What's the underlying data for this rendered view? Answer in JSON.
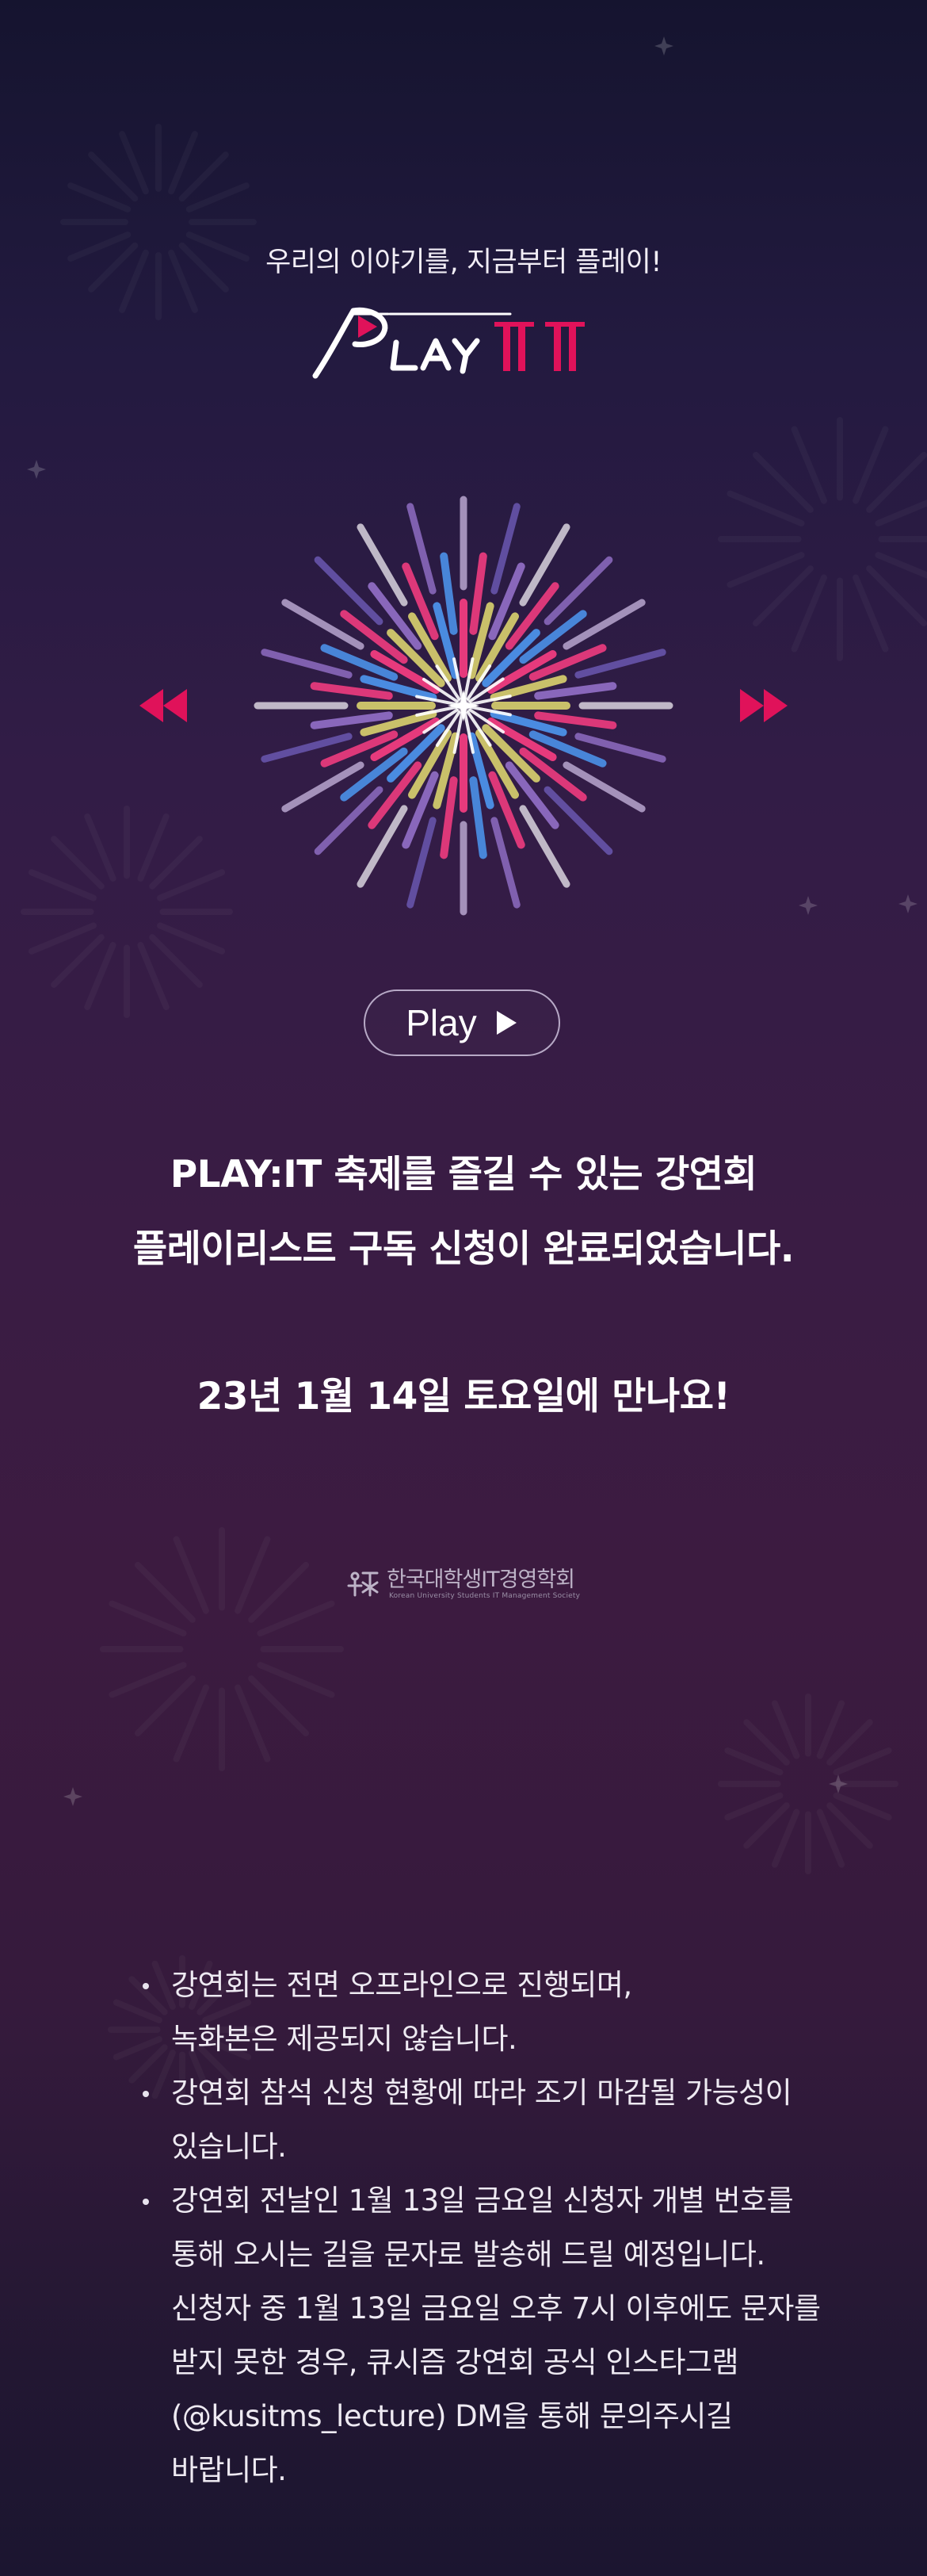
{
  "tagline": "우리의 이야기를, 지금부터 플레이!",
  "logo_text": "PLAY IT",
  "colors": {
    "accent": "#e0125a",
    "background_top": "#15142f",
    "background_mid": "#3a1c44",
    "button_border": "#b7a9c6"
  },
  "carousel": {
    "prev_icon": "rewind-icon",
    "next_icon": "fast-forward-icon"
  },
  "play_button": {
    "label": "Play",
    "icon": "play-icon"
  },
  "confirmation": {
    "line1": "PLAY:IT 축제를 즐길 수 있는 강연회",
    "line2": "플레이리스트 구독 신청이 완료되었습니다.",
    "date_line": "23년 1월 14일 토요일에 만나요!"
  },
  "organization": {
    "name": "한국대학생IT경영학회",
    "subtitle": "Korean University Students IT Management Society"
  },
  "notes": [
    {
      "lines": [
        "강연회는 전면 오프라인으로 진행되며,",
        "녹화본은 제공되지 않습니다."
      ]
    },
    {
      "lines": [
        "강연회 참석 신청 현황에 따라 조기 마감될 가능성이",
        "있습니다."
      ]
    },
    {
      "lines": [
        "강연회 전날인 1월 13일 금요일 신청자 개별 번호를",
        "통해 오시는 길을 문자로 발송해 드릴 예정입니다.",
        "신청자 중 1월 13일 금요일 오후 7시 이후에도 문자를",
        "받지 못한 경우, 큐시즘 강연회 공식 인스타그램",
        "(@kusitms_lecture) DM을 통해 문의주시길",
        "바랍니다."
      ]
    }
  ]
}
